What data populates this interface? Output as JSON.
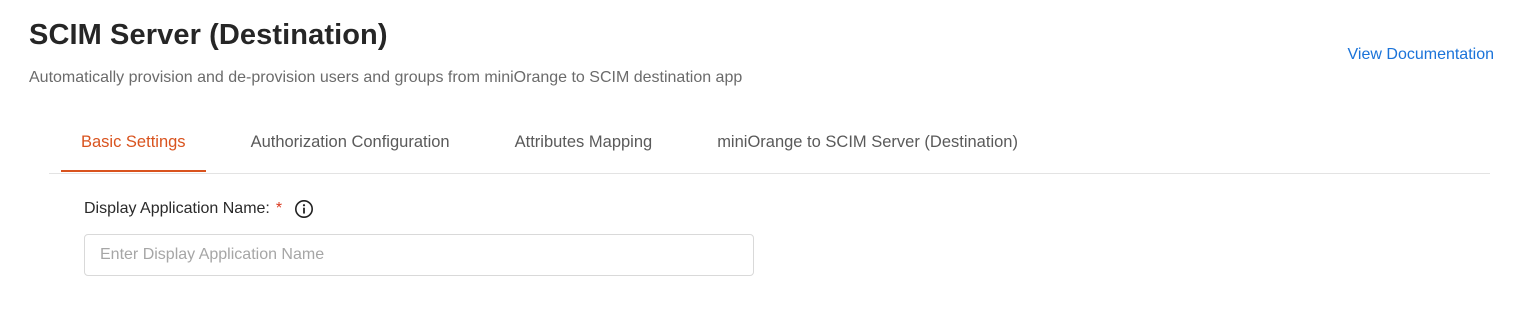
{
  "header": {
    "title": "SCIM Server (Destination)",
    "subtitle": "Automatically provision and de-provision users and groups from miniOrange to SCIM destination app",
    "doc_link": "View Documentation"
  },
  "tabs": [
    {
      "label": "Basic Settings",
      "active": true
    },
    {
      "label": "Authorization Configuration",
      "active": false
    },
    {
      "label": "Attributes Mapping",
      "active": false
    },
    {
      "label": "miniOrange to SCIM Server (Destination)",
      "active": false
    }
  ],
  "form": {
    "display_name": {
      "label": "Display Application Name:",
      "required_mark": "*",
      "value": "",
      "placeholder": "Enter Display Application Name",
      "info_icon": "info-circle-icon"
    }
  },
  "colors": {
    "accent": "#d9531e",
    "link": "#1a73d9",
    "required": "#d9381e"
  }
}
